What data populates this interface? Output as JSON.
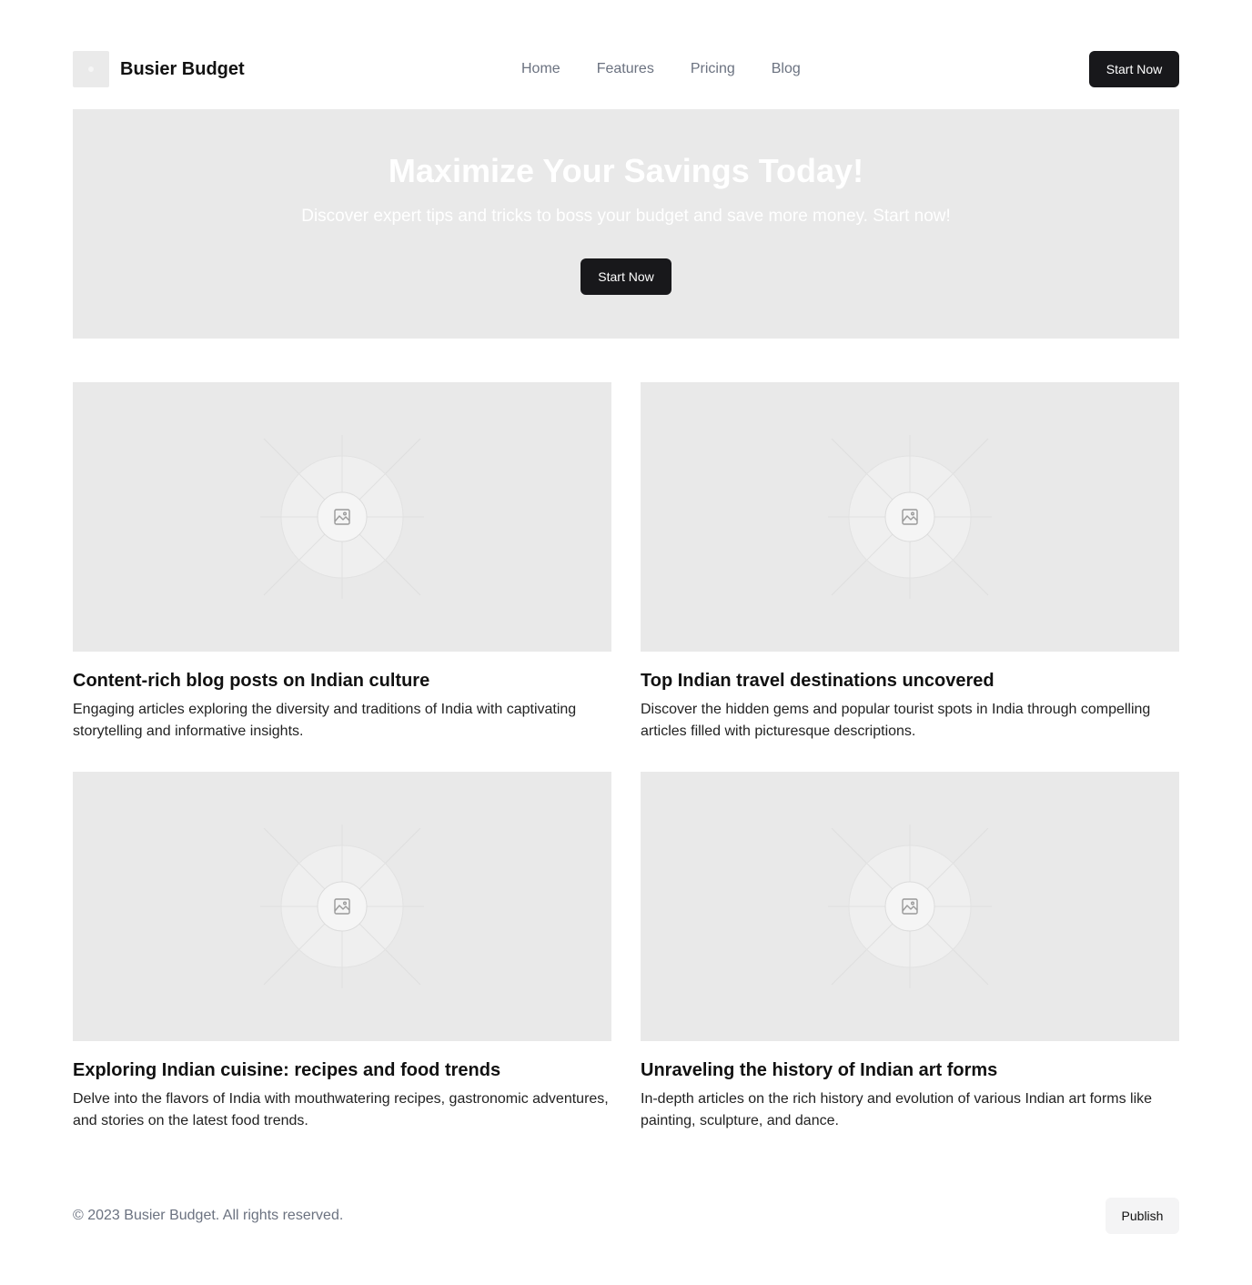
{
  "header": {
    "brand": "Busier Budget",
    "nav": [
      "Home",
      "Features",
      "Pricing",
      "Blog"
    ],
    "cta_label": "Start Now"
  },
  "hero": {
    "title": "Maximize Your Savings Today!",
    "subtitle": "Discover expert tips and tricks to boss your budget and save more money. Start now!",
    "cta_label": "Start Now"
  },
  "cards": [
    {
      "title": "Content-rich blog posts on Indian culture",
      "description": "Engaging articles exploring the diversity and traditions of India with captivating storytelling and informative insights.",
      "image_icon": "image-placeholder-icon"
    },
    {
      "title": "Top Indian travel destinations uncovered",
      "description": "Discover the hidden gems and popular tourist spots in India through compelling articles filled with picturesque descriptions.",
      "image_icon": "image-placeholder-icon"
    },
    {
      "title": "Exploring Indian cuisine: recipes and food trends",
      "description": "Delve into the flavors of India with mouthwatering recipes, gastronomic adventures, and stories on the latest food trends.",
      "image_icon": "image-placeholder-icon"
    },
    {
      "title": "Unraveling the history of Indian art forms",
      "description": "In-depth articles on the rich history and evolution of various Indian art forms like painting, sculpture, and dance.",
      "image_icon": "image-placeholder-icon"
    }
  ],
  "footer": {
    "copyright": "© 2023 Busier Budget. All rights reserved.",
    "publish_label": "Publish"
  },
  "colors": {
    "button_dark": "#18181b",
    "placeholder_bg": "#e9e9e9",
    "muted_text": "#6b7280",
    "button_light": "#f4f4f5"
  }
}
